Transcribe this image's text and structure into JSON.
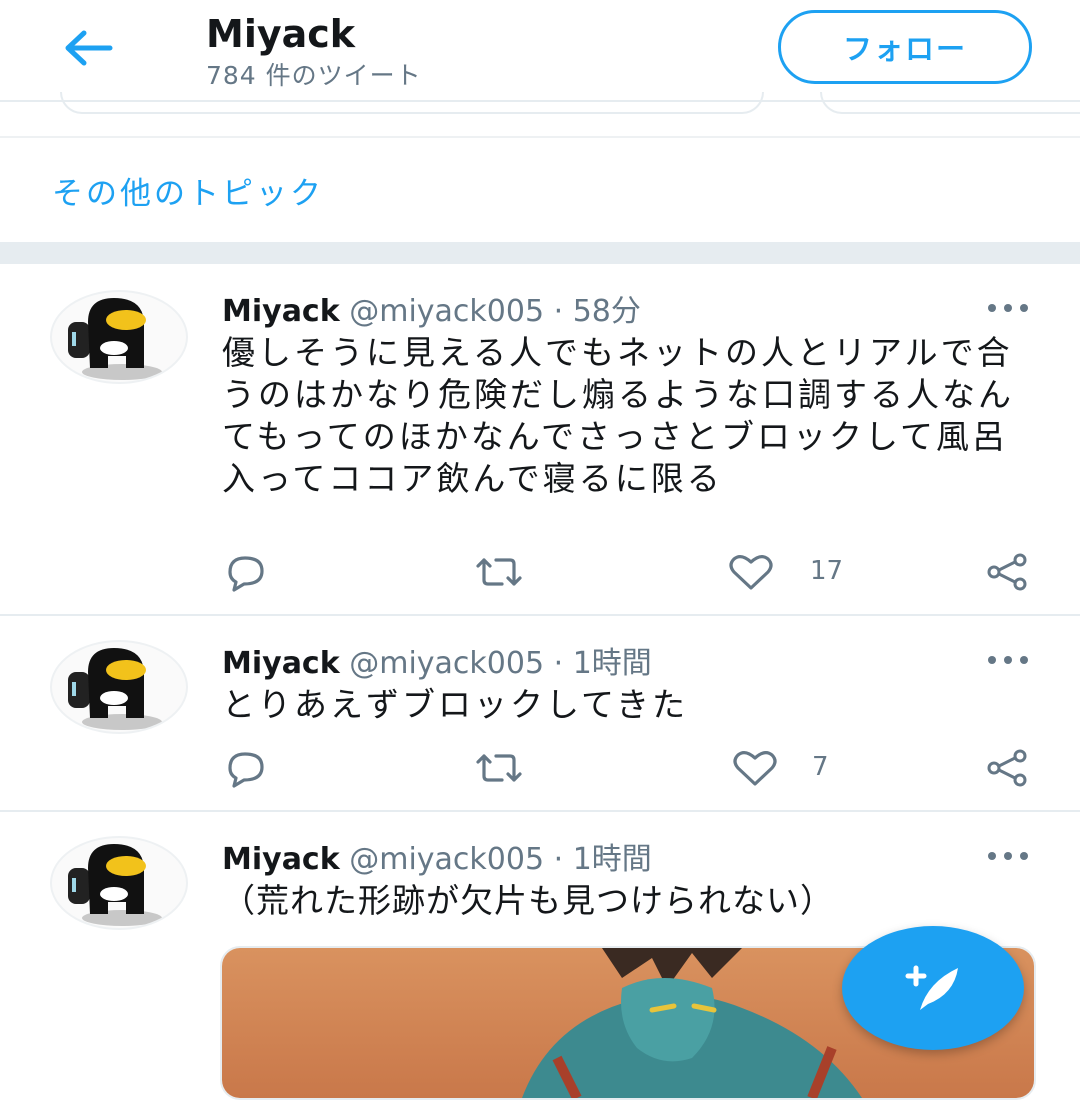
{
  "header": {
    "title": "Miyack",
    "tweet_count": "784 件のツイート",
    "follow_label": "フォロー"
  },
  "topics": {
    "more_topics_label": "その他のトピック"
  },
  "tweets": [
    {
      "name": "Miyack",
      "handle": "@miyack005",
      "separator": "·",
      "time": "58分",
      "text": "優しそうに見える人でもネットの人とリアルで合うのはかなり危険だし煽るような口調する人なんてもってのほかなんでさっさとブロックして風呂入ってココア飲んで寝るに限る",
      "like_count": "17"
    },
    {
      "name": "Miyack",
      "handle": "@miyack005",
      "separator": "·",
      "time": "1時間",
      "text": "とりあえずブロックしてきた",
      "like_count": "7"
    },
    {
      "name": "Miyack",
      "handle": "@miyack005",
      "separator": "·",
      "time": "1時間",
      "text": "（荒れた形跡が欠片も見つけられない）",
      "like_count": ""
    }
  ],
  "icons": [
    "back-arrow-icon",
    "more-icon",
    "reply-icon",
    "retweet-icon",
    "like-icon",
    "share-icon",
    "compose-tweet-icon"
  ],
  "colors": {
    "accent": "#1da1f2",
    "text": "#14171a",
    "secondary": "#657786",
    "border": "#e6ecf0"
  }
}
